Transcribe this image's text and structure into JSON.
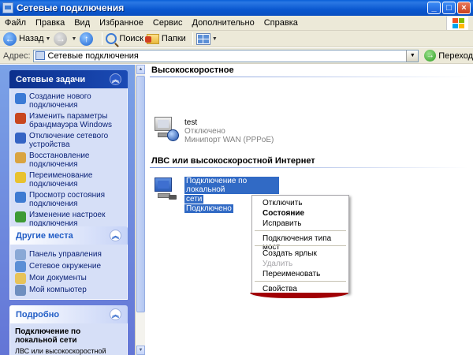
{
  "window": {
    "title": "Сетевые подключения"
  },
  "menu": [
    "Файл",
    "Правка",
    "Вид",
    "Избранное",
    "Сервис",
    "Дополнительно",
    "Справка"
  ],
  "toolbar": {
    "back": "Назад",
    "search": "Поиск",
    "folders": "Папки"
  },
  "address": {
    "label": "Адрес:",
    "value": "Сетевые подключения",
    "go": "Переход"
  },
  "tasks": {
    "header": "Сетевые задачи",
    "items": [
      {
        "label": "Создание нового подключения",
        "color": "#3b7ad5"
      },
      {
        "label": "Изменить параметры брандмауэра Windows",
        "color": "#c8461e"
      },
      {
        "label": "Отключение сетевого устройства",
        "color": "#3564c4"
      },
      {
        "label": "Восстановление подключения",
        "color": "#d9a441"
      },
      {
        "label": "Переименование подключения",
        "color": "#e8c230"
      },
      {
        "label": "Просмотр состояния подключения",
        "color": "#3e7bd2"
      },
      {
        "label": "Изменение настроек подключения",
        "color": "#3d9a34"
      }
    ]
  },
  "places": {
    "header": "Другие места",
    "items": [
      {
        "label": "Панель управления"
      },
      {
        "label": "Сетевое окружение"
      },
      {
        "label": "Мои документы"
      },
      {
        "label": "Мой компьютер"
      }
    ]
  },
  "details": {
    "header": "Подробно",
    "title": "Подключение по локальной сети",
    "sub": "ЛВС или высокоскоростной"
  },
  "groups": {
    "highspeed": "Высокоскоростное",
    "lan": "ЛВС или высокоскоростной Интернет"
  },
  "connections": {
    "test": {
      "name": "test",
      "status": "Отключено",
      "device": "Минипорт WAN (PPPoE)"
    },
    "lan": {
      "name_line1": "Подключение по локальной",
      "name_line2": "сети",
      "status": "Подключено"
    }
  },
  "context_menu": {
    "items": [
      "Отключить",
      "Состояние",
      "Исправить",
      "Подключения типа мост",
      "Создать ярлык",
      "Удалить",
      "Переименовать",
      "Свойства"
    ]
  }
}
